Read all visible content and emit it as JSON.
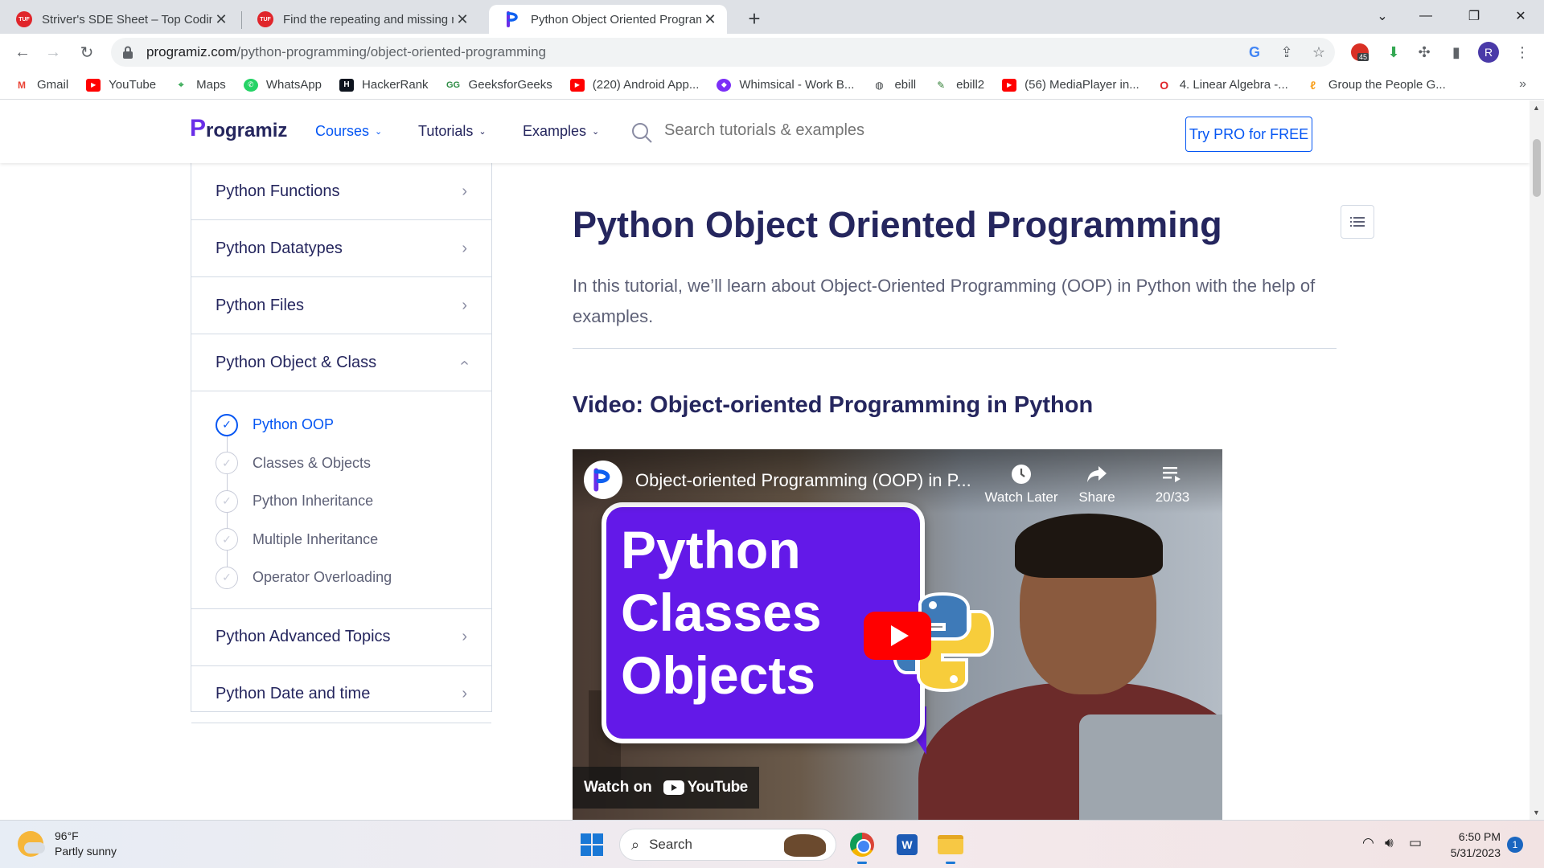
{
  "browser": {
    "tabs": [
      {
        "title": "Striver's SDE Sheet – Top Coding",
        "favicon": "tuf-icon"
      },
      {
        "title": "Find the repeating and missing n",
        "favicon": "tuf-icon"
      },
      {
        "title": "Python Object Oriented Program",
        "favicon": "programiz-icon"
      }
    ],
    "new_tab": "+",
    "url_domain": "programiz.com",
    "url_path": "/python-programming/object-oriented-programming",
    "profile_initial": "R",
    "extension_badge": "45",
    "bookmarks": [
      {
        "label": "Gmail",
        "icon": "gmail-icon"
      },
      {
        "label": "YouTube",
        "icon": "youtube-icon"
      },
      {
        "label": "Maps",
        "icon": "maps-icon"
      },
      {
        "label": "WhatsApp",
        "icon": "whatsapp-icon"
      },
      {
        "label": "HackerRank",
        "icon": "hackerrank-icon"
      },
      {
        "label": "GeeksforGeeks",
        "icon": "gfg-icon"
      },
      {
        "label": "(220) Android App...",
        "icon": "youtube-icon"
      },
      {
        "label": "Whimsical - Work B...",
        "icon": "whimsical-icon"
      },
      {
        "label": "ebill",
        "icon": "globe-icon"
      },
      {
        "label": "ebill2",
        "icon": "leaf-icon"
      },
      {
        "label": "(56) MediaPlayer in...",
        "icon": "youtube-icon"
      },
      {
        "label": "4. Linear Algebra -...",
        "icon": "opera-icon"
      },
      {
        "label": "Group the People G...",
        "icon": "leetcode-icon"
      }
    ],
    "bookmarks_more": "»"
  },
  "site": {
    "logo_text": "rogramiz",
    "logo_letter": "P",
    "nav": [
      {
        "label": "Courses",
        "active": true
      },
      {
        "label": "Tutorials",
        "active": false
      },
      {
        "label": "Examples",
        "active": false
      }
    ],
    "search_placeholder": "Search tutorials & examples",
    "try_pro": "Try PRO for FREE"
  },
  "sidebar": {
    "items_top": [
      "Python Functions",
      "Python Datatypes",
      "Python Files"
    ],
    "open_section": "Python Object & Class",
    "sub_items": [
      {
        "label": "Python OOP",
        "current": true
      },
      {
        "label": "Classes & Objects",
        "current": false
      },
      {
        "label": "Python Inheritance",
        "current": false
      },
      {
        "label": "Multiple Inheritance",
        "current": false
      },
      {
        "label": "Operator Overloading",
        "current": false
      }
    ],
    "items_bottom": [
      "Python Advanced Topics",
      "Python Date and time"
    ]
  },
  "article": {
    "title": "Python Object Oriented Programming",
    "intro": "In this tutorial, we’ll learn about Object-Oriented Programming (OOP) in Python with the help of examples.",
    "video_heading": "Video: Object-oriented Programming in Python",
    "video": {
      "title": "Object-oriented Programming (OOP) in P...",
      "watch_later": "Watch Later",
      "share": "Share",
      "playlist_count": "20/33",
      "thumb_lines": [
        "Python",
        "Classes",
        "Objects"
      ],
      "watch_on": "Watch on",
      "youtube": "YouTube"
    }
  },
  "taskbar": {
    "temperature": "96°F",
    "weather": "Partly sunny",
    "search": "Search",
    "time": "6:50 PM",
    "date": "5/31/2023",
    "notifications": "1"
  }
}
